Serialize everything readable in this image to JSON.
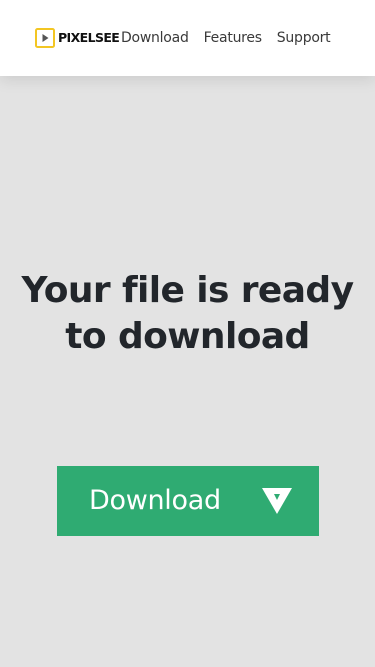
{
  "header": {
    "logo_text": "PIXELSEE",
    "logo_icon": "play-square-icon",
    "nav": [
      {
        "label": "Download"
      },
      {
        "label": "Features"
      },
      {
        "label": "Support"
      }
    ]
  },
  "main": {
    "title": "Your file is ready to download",
    "download_button": {
      "label": "Download",
      "icon": "download-arrow-icon"
    }
  },
  "colors": {
    "background": "#e3e3e3",
    "header_background": "#ffffff",
    "logo_accent": "#f3c623",
    "button": "#2fab72",
    "title_text": "#22262b"
  }
}
